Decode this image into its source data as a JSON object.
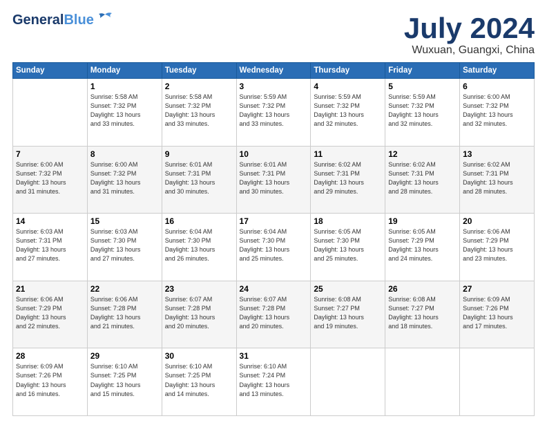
{
  "header": {
    "logo_line1": "General",
    "logo_line2": "Blue",
    "month": "July 2024",
    "location": "Wuxuan, Guangxi, China"
  },
  "days_of_week": [
    "Sunday",
    "Monday",
    "Tuesday",
    "Wednesday",
    "Thursday",
    "Friday",
    "Saturday"
  ],
  "weeks": [
    [
      {
        "num": "",
        "info": ""
      },
      {
        "num": "1",
        "info": "Sunrise: 5:58 AM\nSunset: 7:32 PM\nDaylight: 13 hours\nand 33 minutes."
      },
      {
        "num": "2",
        "info": "Sunrise: 5:58 AM\nSunset: 7:32 PM\nDaylight: 13 hours\nand 33 minutes."
      },
      {
        "num": "3",
        "info": "Sunrise: 5:59 AM\nSunset: 7:32 PM\nDaylight: 13 hours\nand 33 minutes."
      },
      {
        "num": "4",
        "info": "Sunrise: 5:59 AM\nSunset: 7:32 PM\nDaylight: 13 hours\nand 32 minutes."
      },
      {
        "num": "5",
        "info": "Sunrise: 5:59 AM\nSunset: 7:32 PM\nDaylight: 13 hours\nand 32 minutes."
      },
      {
        "num": "6",
        "info": "Sunrise: 6:00 AM\nSunset: 7:32 PM\nDaylight: 13 hours\nand 32 minutes."
      }
    ],
    [
      {
        "num": "7",
        "info": "Sunrise: 6:00 AM\nSunset: 7:32 PM\nDaylight: 13 hours\nand 31 minutes."
      },
      {
        "num": "8",
        "info": "Sunrise: 6:00 AM\nSunset: 7:32 PM\nDaylight: 13 hours\nand 31 minutes."
      },
      {
        "num": "9",
        "info": "Sunrise: 6:01 AM\nSunset: 7:31 PM\nDaylight: 13 hours\nand 30 minutes."
      },
      {
        "num": "10",
        "info": "Sunrise: 6:01 AM\nSunset: 7:31 PM\nDaylight: 13 hours\nand 30 minutes."
      },
      {
        "num": "11",
        "info": "Sunrise: 6:02 AM\nSunset: 7:31 PM\nDaylight: 13 hours\nand 29 minutes."
      },
      {
        "num": "12",
        "info": "Sunrise: 6:02 AM\nSunset: 7:31 PM\nDaylight: 13 hours\nand 28 minutes."
      },
      {
        "num": "13",
        "info": "Sunrise: 6:02 AM\nSunset: 7:31 PM\nDaylight: 13 hours\nand 28 minutes."
      }
    ],
    [
      {
        "num": "14",
        "info": "Sunrise: 6:03 AM\nSunset: 7:31 PM\nDaylight: 13 hours\nand 27 minutes."
      },
      {
        "num": "15",
        "info": "Sunrise: 6:03 AM\nSunset: 7:30 PM\nDaylight: 13 hours\nand 27 minutes."
      },
      {
        "num": "16",
        "info": "Sunrise: 6:04 AM\nSunset: 7:30 PM\nDaylight: 13 hours\nand 26 minutes."
      },
      {
        "num": "17",
        "info": "Sunrise: 6:04 AM\nSunset: 7:30 PM\nDaylight: 13 hours\nand 25 minutes."
      },
      {
        "num": "18",
        "info": "Sunrise: 6:05 AM\nSunset: 7:30 PM\nDaylight: 13 hours\nand 25 minutes."
      },
      {
        "num": "19",
        "info": "Sunrise: 6:05 AM\nSunset: 7:29 PM\nDaylight: 13 hours\nand 24 minutes."
      },
      {
        "num": "20",
        "info": "Sunrise: 6:06 AM\nSunset: 7:29 PM\nDaylight: 13 hours\nand 23 minutes."
      }
    ],
    [
      {
        "num": "21",
        "info": "Sunrise: 6:06 AM\nSunset: 7:29 PM\nDaylight: 13 hours\nand 22 minutes."
      },
      {
        "num": "22",
        "info": "Sunrise: 6:06 AM\nSunset: 7:28 PM\nDaylight: 13 hours\nand 21 minutes."
      },
      {
        "num": "23",
        "info": "Sunrise: 6:07 AM\nSunset: 7:28 PM\nDaylight: 13 hours\nand 20 minutes."
      },
      {
        "num": "24",
        "info": "Sunrise: 6:07 AM\nSunset: 7:28 PM\nDaylight: 13 hours\nand 20 minutes."
      },
      {
        "num": "25",
        "info": "Sunrise: 6:08 AM\nSunset: 7:27 PM\nDaylight: 13 hours\nand 19 minutes."
      },
      {
        "num": "26",
        "info": "Sunrise: 6:08 AM\nSunset: 7:27 PM\nDaylight: 13 hours\nand 18 minutes."
      },
      {
        "num": "27",
        "info": "Sunrise: 6:09 AM\nSunset: 7:26 PM\nDaylight: 13 hours\nand 17 minutes."
      }
    ],
    [
      {
        "num": "28",
        "info": "Sunrise: 6:09 AM\nSunset: 7:26 PM\nDaylight: 13 hours\nand 16 minutes."
      },
      {
        "num": "29",
        "info": "Sunrise: 6:10 AM\nSunset: 7:25 PM\nDaylight: 13 hours\nand 15 minutes."
      },
      {
        "num": "30",
        "info": "Sunrise: 6:10 AM\nSunset: 7:25 PM\nDaylight: 13 hours\nand 14 minutes."
      },
      {
        "num": "31",
        "info": "Sunrise: 6:10 AM\nSunset: 7:24 PM\nDaylight: 13 hours\nand 13 minutes."
      },
      {
        "num": "",
        "info": ""
      },
      {
        "num": "",
        "info": ""
      },
      {
        "num": "",
        "info": ""
      }
    ]
  ]
}
